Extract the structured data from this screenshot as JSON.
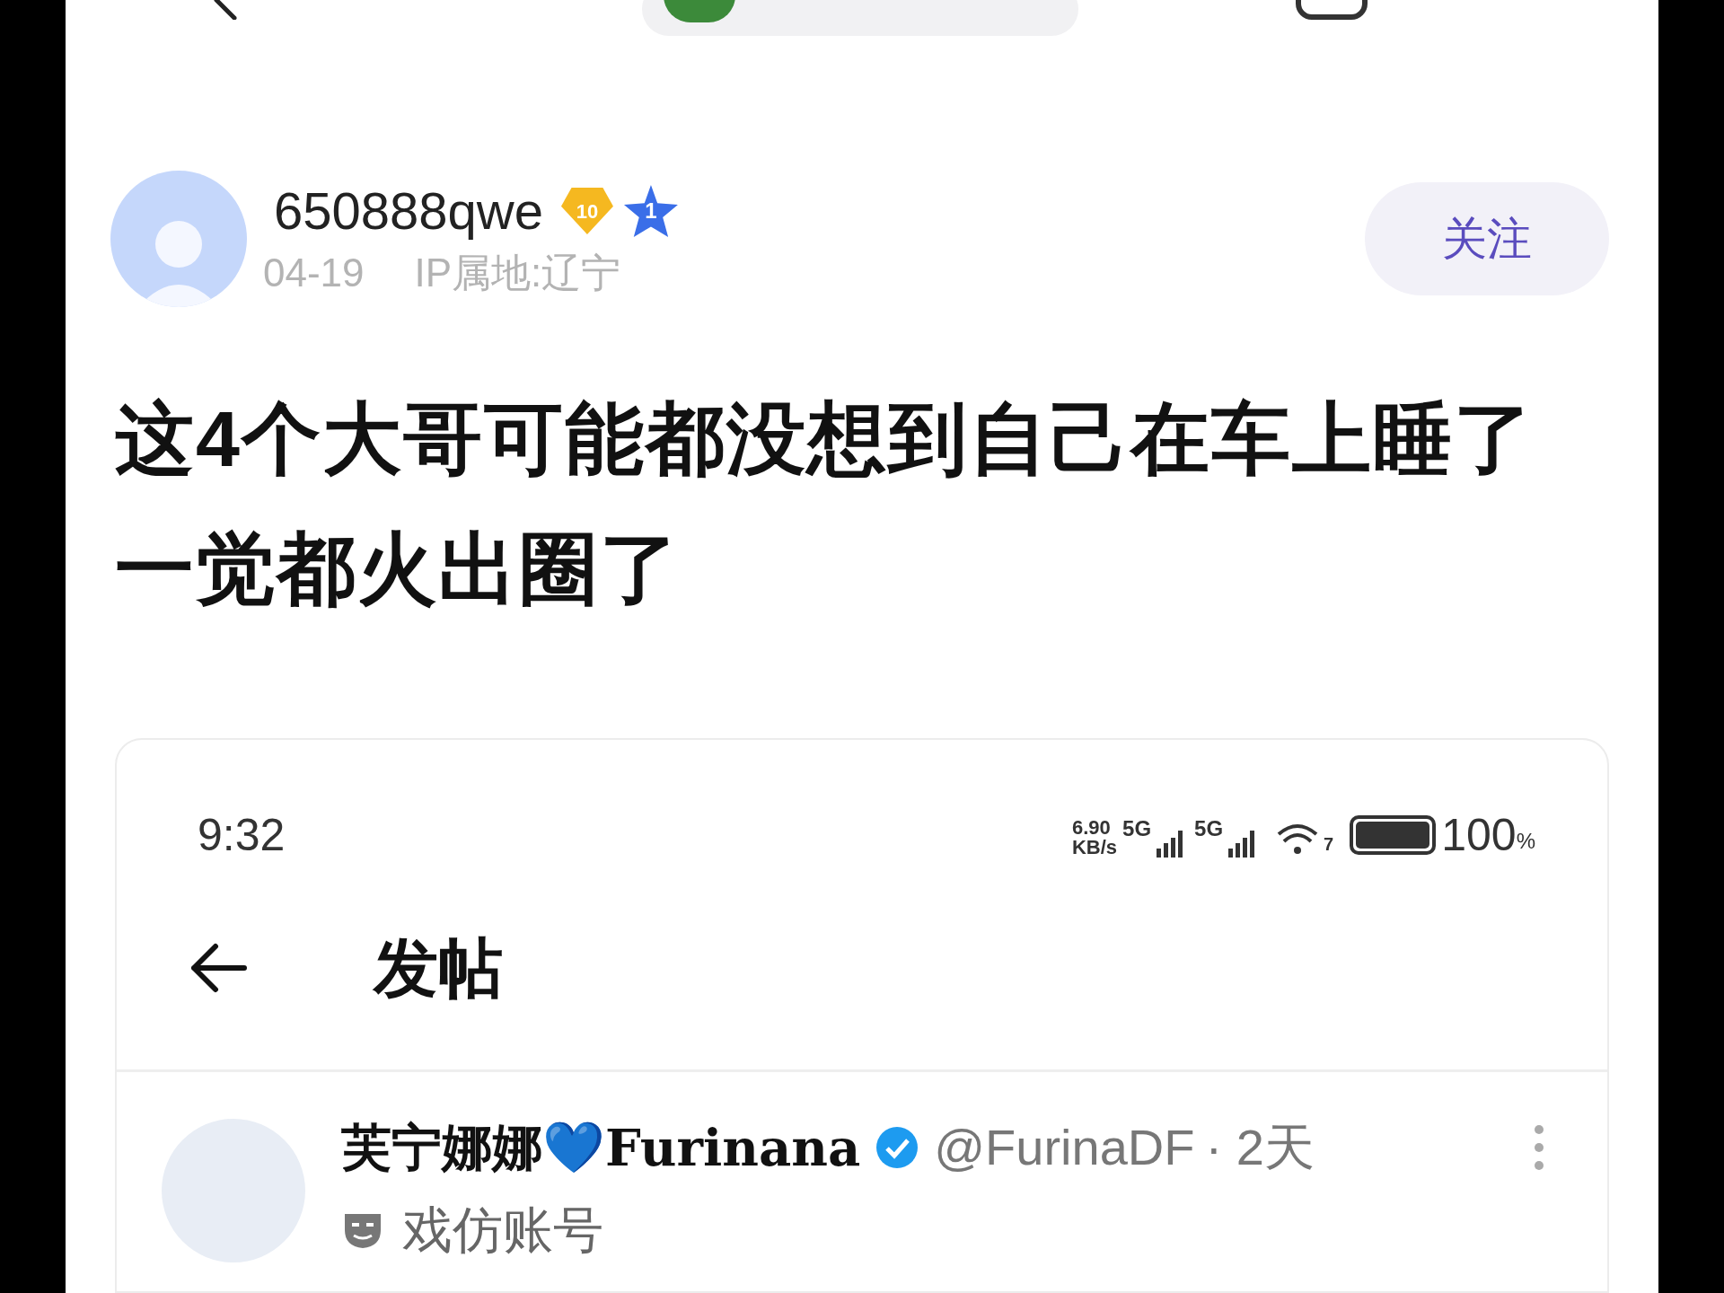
{
  "post": {
    "author": "650888qwe",
    "level_badge": "10",
    "rank_badge": "1",
    "date": "04-19",
    "ip_location": "IP属地:辽宁",
    "follow_button": "关注",
    "title": "这4个大哥可能都没想到自己在车上睡了一觉都火出圈了"
  },
  "screenshot": {
    "status_bar": {
      "time": "9:32",
      "net_speed_value": "6.90",
      "net_speed_unit": "KB/s",
      "network_1": "5G",
      "network_2": "5G",
      "wifi_extra": "7",
      "battery": "100",
      "battery_unit": "%"
    },
    "header": {
      "title": "发帖"
    },
    "tweet": {
      "display_name": "芙宁娜娜💙",
      "display_name_latin": "Furinana",
      "verified": true,
      "handle": "@FurinaDF",
      "time": "· 2天",
      "label": "戏仿账号"
    }
  }
}
